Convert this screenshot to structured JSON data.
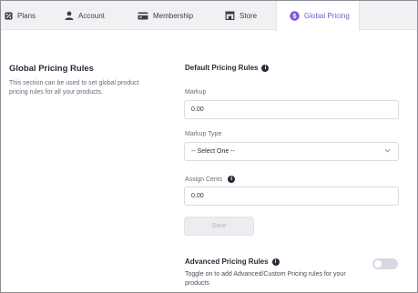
{
  "tabs": [
    {
      "label": "Plans",
      "icon": "percent-icon"
    },
    {
      "label": "Account",
      "icon": "user-icon"
    },
    {
      "label": "Membership",
      "icon": "card-icon"
    },
    {
      "label": "Store",
      "icon": "store-icon"
    },
    {
      "label": "Global Pricing",
      "icon": "dollar-icon",
      "active": true
    }
  ],
  "left": {
    "title": "Global Pricing Rules",
    "description": "This section can be used to set global product pricing rules for all your products."
  },
  "form": {
    "section_title": "Default Pricing Rules",
    "markup_label": "Markup",
    "markup_value": "0.00",
    "markup_type_label": "Markup Type",
    "markup_type_selected": "-- Select One --",
    "assign_cents_label": "Assign Cents",
    "assign_cents_value": "0.00",
    "save_label": "Save"
  },
  "advanced": {
    "title": "Advanced Pricing Rules",
    "description": "Toggle on to add Advanced/Custom Pricing rules for your products",
    "toggle_on": false
  },
  "colors": {
    "accent": "#7b54d6",
    "text": "#2b2b3a",
    "muted": "#6b6b78"
  }
}
